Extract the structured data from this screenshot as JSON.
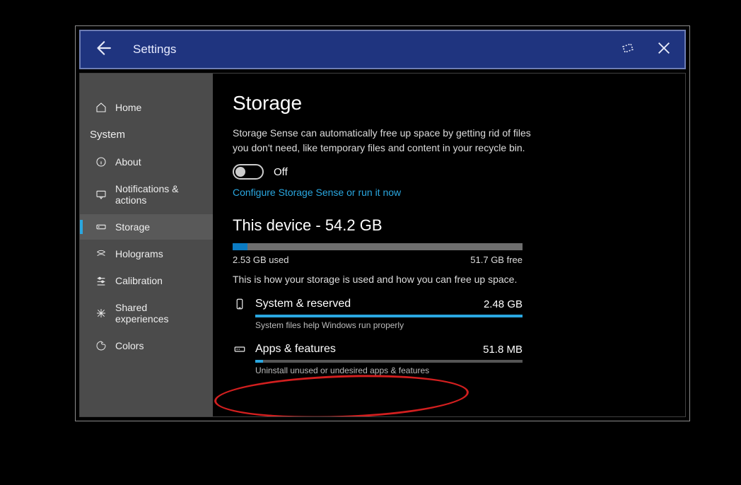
{
  "titlebar": {
    "back_label": "Back",
    "title": "Settings"
  },
  "sidebar": {
    "category": "System",
    "items": [
      {
        "id": "home",
        "label": "Home",
        "active": false
      },
      {
        "id": "about",
        "label": "About",
        "active": false
      },
      {
        "id": "notifications",
        "label": "Notifications & actions",
        "active": false
      },
      {
        "id": "storage",
        "label": "Storage",
        "active": true
      },
      {
        "id": "holograms",
        "label": "Holograms",
        "active": false
      },
      {
        "id": "calibration",
        "label": "Calibration",
        "active": false
      },
      {
        "id": "shared",
        "label": "Shared experiences",
        "active": false
      },
      {
        "id": "colors",
        "label": "Colors",
        "active": false
      }
    ]
  },
  "main": {
    "title": "Storage",
    "sense_desc": "Storage Sense can automatically free up space by getting rid of files you don't need, like temporary files and content in your recycle bin.",
    "toggle_state": "Off",
    "config_link": "Configure Storage Sense or run it now",
    "device_heading": "This device - 54.2 GB",
    "overall_fill_pct": 5,
    "used_label": "2.53 GB used",
    "free_label": "51.7 GB free",
    "usage_desc": "This is how your storage is used and how you can free up space.",
    "categories": [
      {
        "id": "system-reserved",
        "title": "System & reserved",
        "size": "2.48 GB",
        "fill_pct": 100,
        "sub": "System files help Windows run properly"
      },
      {
        "id": "apps-features",
        "title": "Apps & features",
        "size": "51.8 MB",
        "fill_pct": 3,
        "sub": "Uninstall unused or undesired apps & features"
      }
    ]
  }
}
